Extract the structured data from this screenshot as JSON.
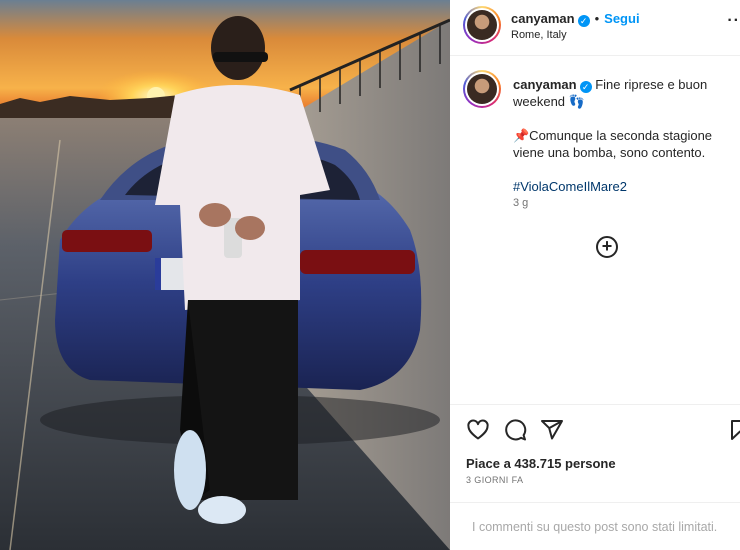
{
  "header": {
    "username": "canyaman",
    "separator": "•",
    "follow_label": "Segui",
    "location": "Rome, Italy",
    "more_label": "··"
  },
  "caption": {
    "username": "canyaman",
    "line1": "Fine riprese e buon weekend 👣",
    "line2": "📌Comunque la seconda stagione viene una bomba, sono contento.",
    "hashtag": "#ViolaComeIlMare2",
    "time_ago": "3 g"
  },
  "add_comment_label": "+",
  "engagement": {
    "likes": "Piace a 438.715 persone",
    "date": "3 GIORNI FA"
  },
  "comments_notice": "I commenti su questo post sono stati limitati.",
  "icons": [
    "heart-icon",
    "comment-icon",
    "share-icon",
    "bookmark-icon",
    "verified-icon",
    "add-circle-icon"
  ],
  "colors": {
    "link_blue": "#0095f6",
    "hashtag_blue": "#00376b",
    "muted": "#737373"
  }
}
